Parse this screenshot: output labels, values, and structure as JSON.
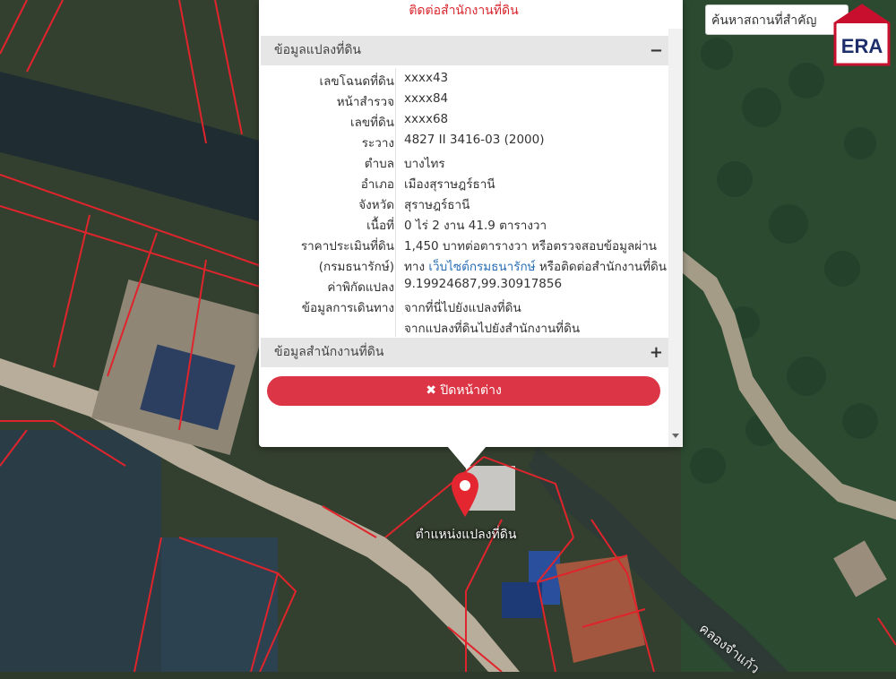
{
  "search": {
    "placeholder": "ค้นหาสถานที่สำคัญ"
  },
  "logo": {
    "text": "ERA"
  },
  "popup": {
    "top_link": "ติดต่อสำนักงานที่ดิน",
    "section1_title": "ข้อมูลแปลงที่ดิน",
    "section1_toggle": "−",
    "section2_title": "ข้อมูลสำนักงานที่ดิน",
    "section2_toggle": "+",
    "rows": [
      {
        "label": "เลขโฉนดที่ดิน",
        "value": "xxxx43"
      },
      {
        "label": "หน้าสำรวจ",
        "value": "xxxx84"
      },
      {
        "label": "เลขที่ดิน",
        "value": "xxxx68"
      },
      {
        "label": "ระวาง",
        "value": "4827 II 3416-03 (2000)"
      },
      {
        "label": "ตำบล",
        "value": "บางไทร"
      },
      {
        "label": "อำเภอ",
        "value": "เมืองสุราษฎร์ธานี"
      },
      {
        "label": "จังหวัด",
        "value": "สุราษฎร์ธานี"
      },
      {
        "label": "เนื้อที่",
        "value": "0 ไร่ 2 งาน 41.9 ตารางวา"
      },
      {
        "label": "ราคาประเมินที่ดิน",
        "value": "1,450 บาทต่อตารางวา หรือตรวจสอบข้อมูลผ่าน"
      },
      {
        "label": "(กรมธนารักษ์)",
        "value_pre": "ทาง ",
        "value_link": "เว็บไซต์กรมธนารักษ์",
        "value_post": " หรือติดต่อสำนักงานที่ดิน"
      },
      {
        "label": "ค่าพิกัดแปลง",
        "value": "9.19924687,99.30917856"
      },
      {
        "label": "ข้อมูลการเดินทาง",
        "value": "จากที่นี่ไปยังแปลงที่ดิน"
      },
      {
        "label": "",
        "value": "จากแปลงที่ดินไปยังสำนักงานที่ดิน"
      }
    ],
    "close_label": "✖ ปิดหน้าต่าง"
  },
  "map": {
    "pin_label": "ตำแหน่งแปลงที่ดิน",
    "canal_label": "คลองจำแก้ว"
  },
  "colors": {
    "accent": "#dc3545",
    "link": "#2a6fb5",
    "parcel_line": "#e0242c"
  }
}
